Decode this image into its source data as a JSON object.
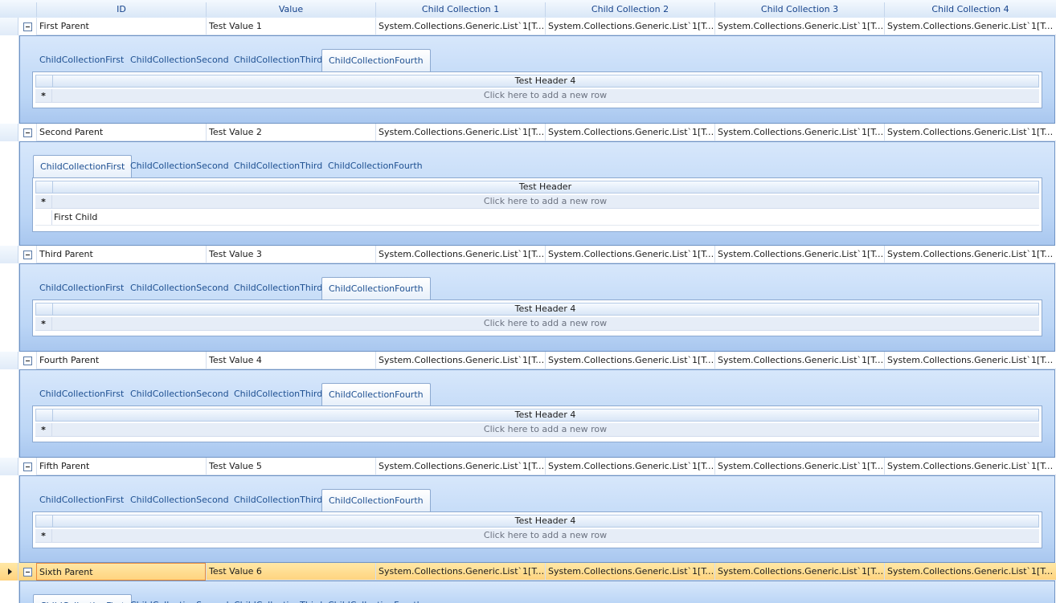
{
  "columns": [
    "ID",
    "Value",
    "Child Collection 1",
    "Child Collection 2",
    "Child Collection 3",
    "Child Collection 4"
  ],
  "tab_labels": [
    "ChildCollectionFirst",
    "ChildCollectionSecond",
    "ChildCollectionThird",
    "ChildCollectionFourth"
  ],
  "new_row_text": "Click here to add a new row",
  "rows": [
    {
      "id": "First Parent",
      "value": "Test Value 1",
      "c1": "System.Collections.Generic.List`1[Teleri...",
      "c2": "System.Collections.Generic.List`1[Teleri...",
      "c3": "System.Collections.Generic.List`1[Teleri...",
      "c4": "System.Collections.Generic.List`1[Telerik...",
      "child": {
        "header": "Test Header 4",
        "children": []
      }
    },
    {
      "id": "Second Parent",
      "value": "Test Value 2",
      "c1": "System.Collections.Generic.List`1[Teleri...",
      "c2": "System.Collections.Generic.List`1[Teleri...",
      "c3": "System.Collections.Generic.List`1[Teleri...",
      "c4": "System.Collections.Generic.List`1[Telerik...",
      "child": {
        "header": "Test Header",
        "children": [
          "First Child"
        ]
      }
    },
    {
      "id": "Third Parent",
      "value": "Test Value 3",
      "c1": "System.Collections.Generic.List`1[Teleri...",
      "c2": "System.Collections.Generic.List`1[Teleri...",
      "c3": "System.Collections.Generic.List`1[Teleri...",
      "c4": "System.Collections.Generic.List`1[Telerik...",
      "child": {
        "header": "Test Header 4",
        "children": []
      }
    },
    {
      "id": "Fourth Parent",
      "value": "Test Value 4",
      "c1": "System.Collections.Generic.List`1[Teleri...",
      "c2": "System.Collections.Generic.List`1[Teleri...",
      "c3": "System.Collections.Generic.List`1[Teleri...",
      "c4": "System.Collections.Generic.List`1[Telerik...",
      "child": {
        "header": "Test Header 4",
        "children": []
      }
    },
    {
      "id": "Fifth Parent",
      "value": "Test Value 5",
      "c1": "System.Collections.Generic.List`1[Teleri...",
      "c2": "System.Collections.Generic.List`1[Teleri...",
      "c3": "System.Collections.Generic.List`1[Teleri...",
      "c4": "System.Collections.Generic.List`1[Telerik...",
      "child": {
        "header": "Test Header 4",
        "children": []
      }
    },
    {
      "id": "Sixth Parent",
      "value": "Test Value 6",
      "c1": "System.Collections.Generic.List`1[Teleri...",
      "c2": "System.Collections.Generic.List`1[Teleri...",
      "c3": "System.Collections.Generic.List`1[Teleri...",
      "c4": "System.Collections.Generic.List`1[Telerik...",
      "child": {
        "header": "",
        "children": []
      }
    }
  ],
  "active_tabs": [
    3,
    0,
    3,
    3,
    3,
    0
  ],
  "selected_row": 5,
  "colors": {
    "header_text": "#15428b",
    "tab_text": "#1d4f91",
    "selection": "#ffd37d",
    "focus_border": "#e98a3b"
  }
}
